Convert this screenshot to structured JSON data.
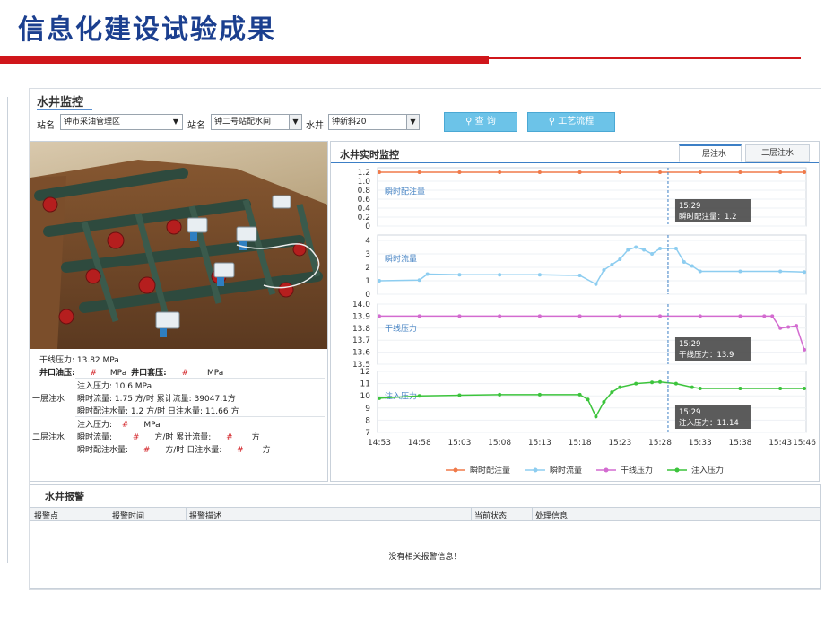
{
  "slide": {
    "title": "信息化建设试验成果"
  },
  "app": {
    "title": "水井监控"
  },
  "toolbar": {
    "station_label": "站名",
    "station_value": "钟市采油管理区",
    "substation_label": "站名",
    "substation_value": "钟二号站配水间",
    "well_label": "水井",
    "well_value": "钟新斜20",
    "query_button": "查 询",
    "process_button": "工艺流程",
    "search_icon": "search-icon"
  },
  "readouts": {
    "trunk_pressure": "干线压力: 13.82  MPa",
    "wellhead_oil_label": "井口油压:",
    "wellhead_oil_value": "#",
    "mpa1": "MPa",
    "wellhead_casing_label": "井口套压:",
    "wellhead_casing_value": "#",
    "mpa2": "MPa",
    "layer1_label": "一层注水",
    "layer1_inj_pressure": "注入压力:  10.6  MPa",
    "layer1_flow": "瞬时流量:   1.75  方/时 累计流量: 39047.1方",
    "layer1_alloc": "瞬时配注水量:    1.2    方/时 日注水量:  11.66  方",
    "layer2_label": "二层注水",
    "layer2_inj_label": "注入压力:",
    "layer2_inj_value": "#",
    "layer2_inj_unit": "MPa",
    "layer2_flow_label": "瞬时流量:",
    "layer2_flow_value": "#",
    "layer2_flow_mid": "方/时 累计流量:",
    "layer2_flow_total": "#",
    "layer2_flow_unit": "方",
    "layer2_alloc_label": "瞬时配注水量:",
    "layer2_alloc_value": "#",
    "layer2_alloc_mid": "方/时 日注水量:",
    "layer2_alloc_day": "#",
    "layer2_alloc_unit": "方"
  },
  "realtime": {
    "title": "水井实时监控",
    "tabs": [
      "一层注水",
      "二层注水"
    ],
    "active_tab": 0
  },
  "chart_data": {
    "type": "line",
    "x_ticks": [
      "14:53",
      "14:58",
      "15:03",
      "15:08",
      "15:13",
      "15:18",
      "15:23",
      "15:28",
      "15:33",
      "15:38",
      "15:43",
      "15:46"
    ],
    "cursor_time": "15:29",
    "legend": [
      "瞬时配注量",
      "瞬时流量",
      "干线压力",
      "注入压力"
    ],
    "panels": [
      {
        "name": "瞬时配注量",
        "color": "#f07a4a",
        "yticks": [
          "1.2",
          "1.0",
          "0.8",
          "0.6",
          "0.4",
          "0.2",
          "0"
        ],
        "ylim": [
          0,
          1.3
        ],
        "x": [
          "14:53",
          "14:58",
          "15:03",
          "15:08",
          "15:13",
          "15:18",
          "15:23",
          "15:28",
          "15:33",
          "15:38",
          "15:43",
          "15:46"
        ],
        "values": [
          1.2,
          1.2,
          1.2,
          1.2,
          1.2,
          1.2,
          1.2,
          1.2,
          1.2,
          1.2,
          1.2,
          1.2
        ],
        "tooltip": [
          "15:29",
          "瞬时配注量：1.2"
        ]
      },
      {
        "name": "瞬时流量",
        "color": "#8dcdf0",
        "yticks": [
          "4",
          "3",
          "2",
          "1",
          "0"
        ],
        "ylim": [
          0,
          4.4
        ],
        "x": [
          "14:53",
          "14:58",
          "14:59",
          "15:03",
          "15:08",
          "15:13",
          "15:18",
          "15:20",
          "15:21",
          "15:22",
          "15:23",
          "15:24",
          "15:25",
          "15:26",
          "15:27",
          "15:28",
          "15:30",
          "15:31",
          "15:32",
          "15:33",
          "15:38",
          "15:43",
          "15:46"
        ],
        "values": [
          1.0,
          1.05,
          1.5,
          1.45,
          1.45,
          1.45,
          1.4,
          0.75,
          1.8,
          2.2,
          2.6,
          3.3,
          3.5,
          3.3,
          3.0,
          3.4,
          3.4,
          2.4,
          2.1,
          1.7,
          1.7,
          1.7,
          1.65
        ]
      },
      {
        "name": "干线压力",
        "color": "#d36bd0",
        "yticks": [
          "14.0",
          "13.9",
          "13.8",
          "13.7",
          "13.6",
          "13.5"
        ],
        "ylim": [
          13.5,
          14.0
        ],
        "x": [
          "14:53",
          "14:58",
          "15:03",
          "15:08",
          "15:13",
          "15:18",
          "15:23",
          "15:28",
          "15:33",
          "15:38",
          "15:41",
          "15:42",
          "15:43",
          "15:44",
          "15:45",
          "15:46"
        ],
        "values": [
          13.9,
          13.9,
          13.9,
          13.9,
          13.9,
          13.9,
          13.9,
          13.9,
          13.9,
          13.9,
          13.9,
          13.9,
          13.8,
          13.81,
          13.82,
          13.62
        ],
        "tooltip": [
          "15:29",
          "干线压力：13.9"
        ]
      },
      {
        "name": "注入压力",
        "color": "#3cc43c",
        "yticks": [
          "12",
          "11",
          "10",
          "9",
          "8",
          "7"
        ],
        "ylim": [
          7,
          12
        ],
        "x": [
          "14:53",
          "14:58",
          "15:03",
          "15:08",
          "15:13",
          "15:18",
          "15:19",
          "15:20",
          "15:21",
          "15:22",
          "15:23",
          "15:25",
          "15:27",
          "15:28",
          "15:30",
          "15:32",
          "15:33",
          "15:38",
          "15:43",
          "15:46"
        ],
        "values": [
          9.8,
          10.0,
          10.05,
          10.1,
          10.1,
          10.1,
          9.7,
          8.3,
          9.5,
          10.3,
          10.7,
          11.0,
          11.1,
          11.14,
          11.0,
          10.7,
          10.6,
          10.6,
          10.6,
          10.6
        ],
        "tooltip": [
          "15:29",
          "注入压力：11.14"
        ]
      }
    ]
  },
  "alarm": {
    "title": "水井报警",
    "columns": [
      "报警点",
      "报警时间",
      "报警描述",
      "当前状态",
      "处理信息"
    ],
    "empty_message": "没有相关报警信息！"
  }
}
